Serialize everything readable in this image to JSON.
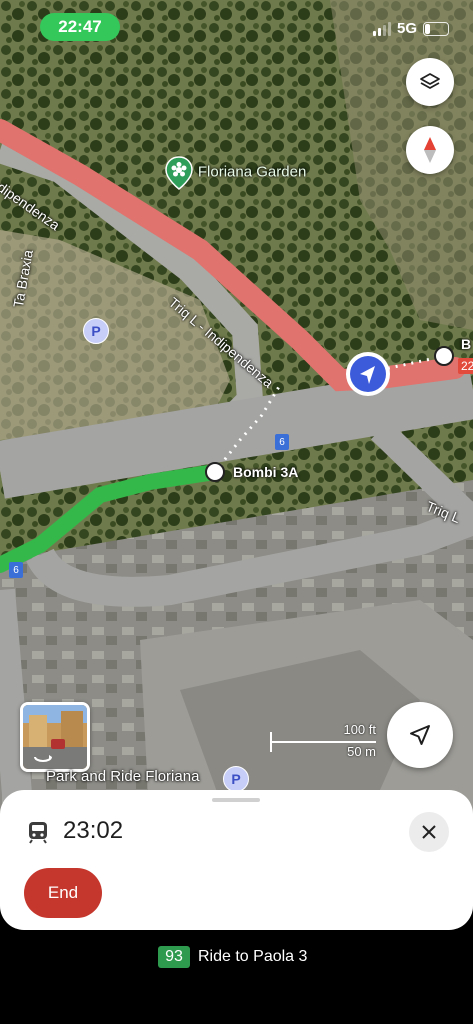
{
  "status_bar": {
    "time": "22:47",
    "network": "5G"
  },
  "map": {
    "poi_name": "Floriana Garden",
    "street_labels": [
      "Indipendenza",
      "Triq L - Indipendenza",
      "Ta Braxia",
      "Triq L"
    ],
    "stop_label": "Bombi 3A",
    "stop_edge_label": "B",
    "edge_badge": "22",
    "route_shields": [
      "6",
      "6"
    ],
    "parking_label": "Park and Ride Floriana",
    "parking_symbol": "P",
    "scale": {
      "feet": "100 ft",
      "meters": "50 m"
    },
    "route_colors": {
      "walk_red": "#e0736d",
      "bus_green": "#35b84a"
    }
  },
  "controls": {
    "layers_icon": "layers-icon",
    "compass_icon": "compass-icon",
    "recenter_icon": "navigation-arrow-icon",
    "street_view_icon": "street-view-thumbnail"
  },
  "sheet": {
    "eta_icon": "train-icon",
    "eta_time": "23:02",
    "end_label": "End",
    "close_icon": "close-icon"
  },
  "bottom": {
    "route_number": "93",
    "ride_text": "Ride to Paola 3"
  },
  "colors": {
    "end_button": "#c5372c",
    "status_pill": "#34c759",
    "route_badge": "#2e9a4d"
  }
}
